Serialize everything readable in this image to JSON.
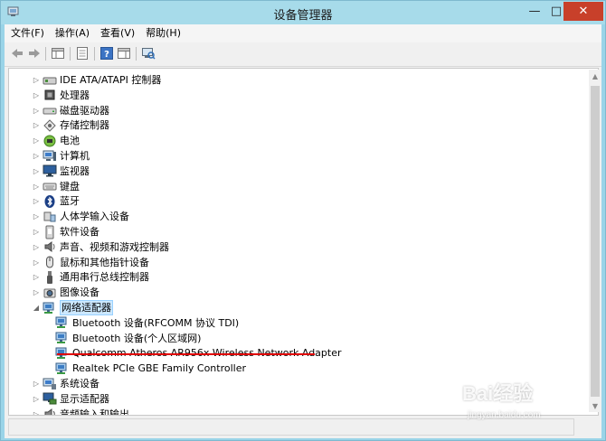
{
  "window": {
    "title": "设备管理器"
  },
  "menu": [
    "文件(F)",
    "操作(A)",
    "查看(V)",
    "帮助(H)"
  ],
  "tree": [
    {
      "label": "IDE ATA/ATAPI 控制器",
      "level": 1,
      "expanded": false,
      "icon": "ide-controller-icon"
    },
    {
      "label": "处理器",
      "level": 1,
      "expanded": false,
      "icon": "processor-icon"
    },
    {
      "label": "磁盘驱动器",
      "level": 1,
      "expanded": false,
      "icon": "disk-drive-icon"
    },
    {
      "label": "存储控制器",
      "level": 1,
      "expanded": false,
      "icon": "storage-controller-icon"
    },
    {
      "label": "电池",
      "level": 1,
      "expanded": false,
      "icon": "battery-icon"
    },
    {
      "label": "计算机",
      "level": 1,
      "expanded": false,
      "icon": "computer-icon"
    },
    {
      "label": "监视器",
      "level": 1,
      "expanded": false,
      "icon": "monitor-icon"
    },
    {
      "label": "键盘",
      "level": 1,
      "expanded": false,
      "icon": "keyboard-icon"
    },
    {
      "label": "蓝牙",
      "level": 1,
      "expanded": false,
      "icon": "bluetooth-icon"
    },
    {
      "label": "人体学输入设备",
      "level": 1,
      "expanded": false,
      "icon": "hid-icon"
    },
    {
      "label": "软件设备",
      "level": 1,
      "expanded": false,
      "icon": "software-device-icon"
    },
    {
      "label": "声音、视频和游戏控制器",
      "level": 1,
      "expanded": false,
      "icon": "speaker-icon"
    },
    {
      "label": "鼠标和其他指针设备",
      "level": 1,
      "expanded": false,
      "icon": "mouse-icon"
    },
    {
      "label": "通用串行总线控制器",
      "level": 1,
      "expanded": false,
      "icon": "usb-icon"
    },
    {
      "label": "图像设备",
      "level": 1,
      "expanded": false,
      "icon": "camera-icon"
    },
    {
      "label": "网络适配器",
      "level": 1,
      "expanded": true,
      "selected": true,
      "icon": "network-adapter-icon"
    },
    {
      "label": "Bluetooth 设备(RFCOMM 协议 TDI)",
      "level": 2,
      "icon": "network-adapter-icon"
    },
    {
      "label": "Bluetooth 设备(个人区域网)",
      "level": 2,
      "icon": "network-adapter-icon"
    },
    {
      "label": "Qualcomm Atheros AR956x Wireless Network Adapter",
      "level": 2,
      "icon": "network-adapter-icon"
    },
    {
      "label": "Realtek PCIe GBE Family Controller",
      "level": 2,
      "icon": "network-adapter-icon"
    },
    {
      "label": "系统设备",
      "level": 1,
      "expanded": false,
      "icon": "system-device-icon"
    },
    {
      "label": "显示适配器",
      "level": 1,
      "expanded": false,
      "icon": "display-adapter-icon"
    },
    {
      "label": "音频输入和输出",
      "level": 1,
      "expanded": false,
      "icon": "audio-io-icon"
    }
  ],
  "watermark": {
    "main": "Bai经验",
    "sub": "jingyan.baidu.com"
  },
  "colors": {
    "titlebar": "#a7dbea",
    "close": "#c8402a",
    "selection": "#cce8ff",
    "highlight_underline": "#e00000"
  }
}
